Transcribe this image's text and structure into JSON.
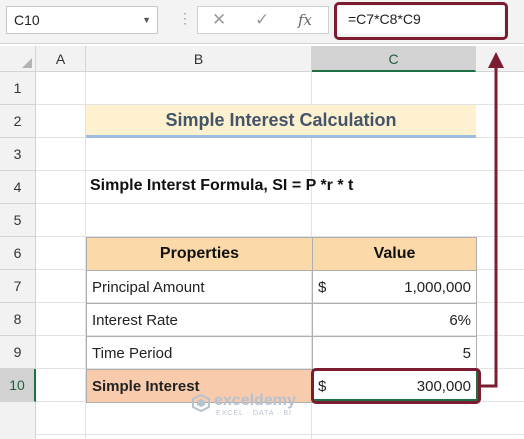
{
  "name_box": {
    "value": "C10"
  },
  "formula_bar": {
    "cancel_icon": "x-icon",
    "enter_icon": "check-icon",
    "function_icon": "fx-icon",
    "fx_label": "fx",
    "formula": "=C7*C8*C9"
  },
  "columns": [
    "A",
    "B",
    "C"
  ],
  "selected_column": "C",
  "rows": [
    "1",
    "2",
    "3",
    "4",
    "5",
    "6",
    "7",
    "8",
    "9",
    "10"
  ],
  "selected_row": "10",
  "title": "Simple Interest Calculation",
  "formula_text": "Simple Interst Formula, SI = P *r * t",
  "table": {
    "headers": [
      "Properties",
      "Value"
    ],
    "rows": [
      {
        "label": "Principal Amount",
        "currency": "$",
        "value": "1,000,000"
      },
      {
        "label": "Interest Rate",
        "currency": "",
        "value": "6%"
      },
      {
        "label": "Time Period",
        "currency": "",
        "value": "5"
      },
      {
        "label": "Simple Interest",
        "currency": "$",
        "value": "300,000"
      }
    ]
  },
  "watermark": {
    "name": "exceldemy",
    "tagline": "EXCEL · DATA · BI"
  },
  "colors": {
    "highlight_border": "#7b1c30",
    "title_fill": "#fdf1cf",
    "header_fill": "#fcd9a8",
    "result_fill": "#f8cbad",
    "selection": "#1e7145"
  }
}
